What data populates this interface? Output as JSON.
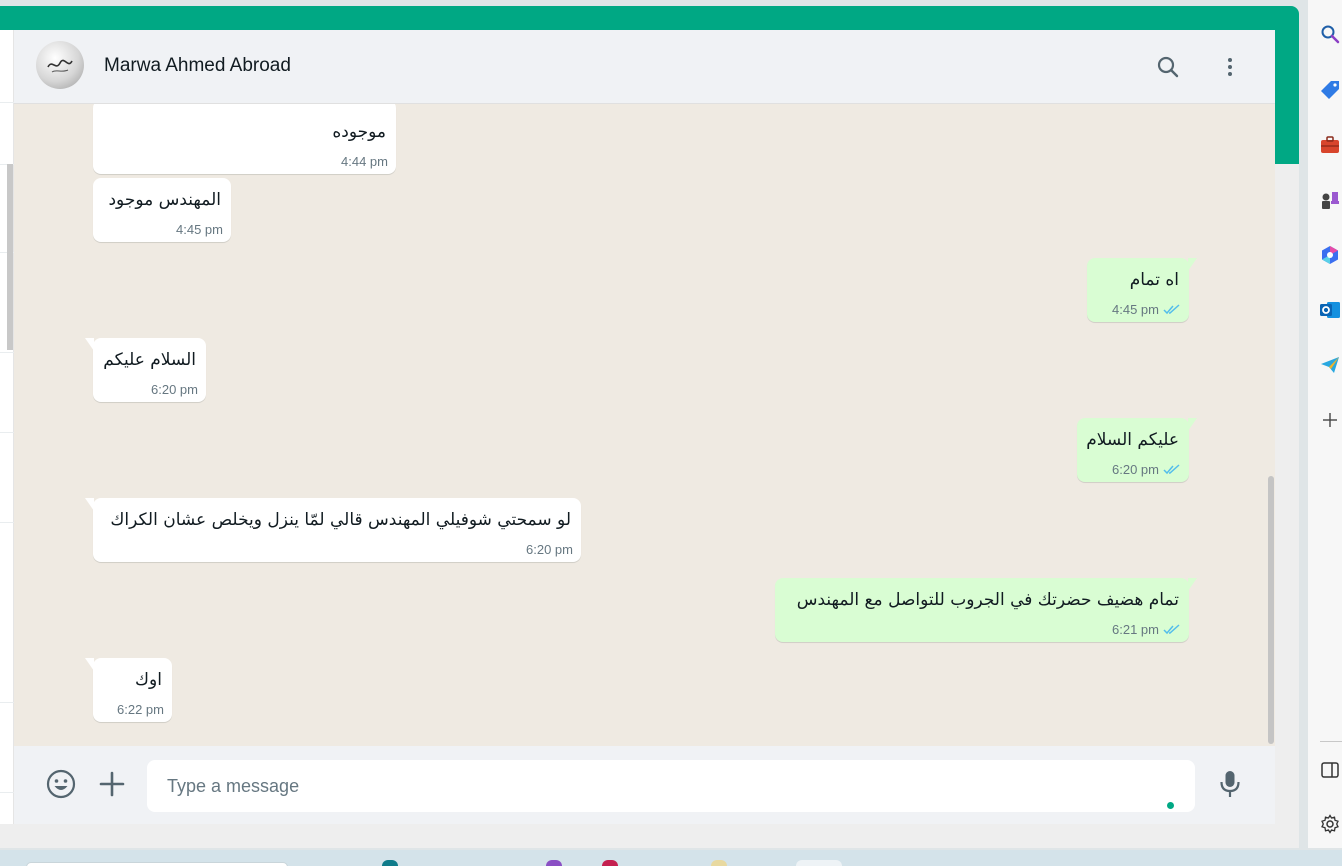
{
  "header": {
    "contact_name": "Marwa Ahmed Abroad",
    "avatar_icon": "profile-picture"
  },
  "messages": [
    {
      "direction": "in",
      "text": "موجوده",
      "time": "4:44 pm"
    },
    {
      "direction": "in",
      "text": "المهندس موجود",
      "time": "4:45 pm"
    },
    {
      "direction": "out",
      "text": "اه تمام",
      "time": "4:45 pm",
      "status": "read"
    },
    {
      "direction": "in",
      "text": "السلام عليكم",
      "time": "6:20 pm"
    },
    {
      "direction": "out",
      "text": "عليكم السلام",
      "time": "6:20 pm",
      "status": "read"
    },
    {
      "direction": "in",
      "text": "لو سمحتي شوفيلي المهندس قالي لمّا ينزل ويخلص عشان الكراك",
      "time": "6:20 pm"
    },
    {
      "direction": "out",
      "text": "تمام هضيف حضرتك في الجروب للتواصل مع المهندس",
      "time": "6:21 pm",
      "status": "read"
    },
    {
      "direction": "in",
      "text": "اوك",
      "time": "6:22 pm"
    }
  ],
  "composer": {
    "placeholder": "Type a message"
  },
  "colors": {
    "brand": "#00a884",
    "outgoing_bubble": "#d9fdd3",
    "incoming_bubble": "#ffffff",
    "chat_background": "#efeae2",
    "read_tick": "#53bdeb"
  },
  "sidebar_icons": [
    "search-icon",
    "tag-icon",
    "briefcase-icon",
    "chess-icon",
    "copilot-icon",
    "outlook-icon",
    "telegram-icon",
    "plus-icon",
    "panel-icon",
    "settings-icon"
  ]
}
